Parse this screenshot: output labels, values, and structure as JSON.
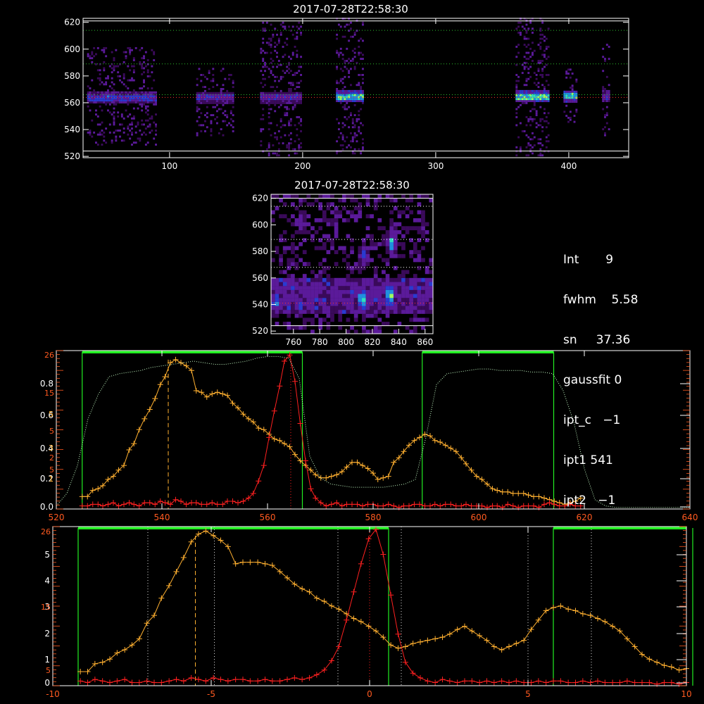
{
  "panel1": {
    "title": "2017-07-28T22:58:30",
    "xlim": [
      35,
      445
    ],
    "ylim": [
      519,
      623
    ],
    "xticks": [
      100,
      200,
      300,
      400
    ],
    "yticks": [
      520,
      540,
      560,
      580,
      600,
      620
    ],
    "hlines_dotted": [
      614,
      589,
      566
    ],
    "hlines_solid": [
      621,
      524
    ],
    "hline_red": 564,
    "bands": [
      {
        "x0": 38,
        "x1": 90,
        "ymin": 528,
        "ymax": 600,
        "core": 563,
        "hot": 0.55
      },
      {
        "x0": 120,
        "x1": 148,
        "ymin": 535,
        "ymax": 585,
        "core": 563,
        "hot": 0.45
      },
      {
        "x0": 168,
        "x1": 198,
        "ymin": 520,
        "ymax": 620,
        "core": 563,
        "hot": 0.45
      },
      {
        "x0": 225,
        "x1": 245,
        "ymin": 520,
        "ymax": 622,
        "core": 564,
        "hot": 0.85
      },
      {
        "x0": 360,
        "x1": 385,
        "ymin": 520,
        "ymax": 622,
        "core": 564,
        "hot": 0.9
      },
      {
        "x0": 396,
        "x1": 405,
        "ymin": 545,
        "ymax": 585,
        "core": 564,
        "hot": 0.85
      },
      {
        "x0": 425,
        "x1": 430,
        "ymin": 535,
        "ymax": 605,
        "core": 564,
        "hot": 0.5
      }
    ]
  },
  "panel2": {
    "title": "2017-07-28T22:58:30",
    "xlim": [
      743,
      866
    ],
    "ylim": [
      518,
      623
    ],
    "xticks": [
      760,
      780,
      800,
      820,
      840,
      860
    ],
    "yticks": [
      520,
      540,
      560,
      580,
      600,
      620
    ],
    "hlines_dotted": [
      614,
      589,
      568
    ],
    "hlines_solid": [
      620,
      524
    ],
    "hline_red": 541
  },
  "info": {
    "lines": [
      "Int       9",
      "fwhm    5.58",
      "sn     37.36",
      "gaussfit 0",
      "ipt_c   −1",
      "ipt1 541",
      "ipt2   −1"
    ]
  },
  "chart_data": [
    {
      "type": "line",
      "name": "panel3",
      "xlim": [
        520,
        640
      ],
      "xticks": [
        520,
        540,
        560,
        580,
        600,
        620,
        640
      ],
      "left_ticks_white": [
        "0.0",
        "0.2",
        "0.4",
        "0.6",
        "0.8"
      ],
      "left_ticks_red": [
        "5",
        "2",
        "5",
        "15",
        "26"
      ],
      "left_ticks_orange": [
        "1",
        "3",
        "5"
      ],
      "green_windows": [
        [
          524.9,
          566.6
        ],
        [
          589.3,
          614.2
        ]
      ],
      "vlines": [
        {
          "x": 541.2,
          "style": "dashed",
          "color": "orange"
        },
        {
          "x": 564.4,
          "style": "dotted",
          "color": "red"
        }
      ],
      "series": [
        {
          "color": "orange",
          "marker": "plus",
          "x": [
            524.9,
            525.9,
            526.9,
            527.9,
            528.8,
            529.8,
            530.8,
            531.8,
            532.8,
            533.8,
            534.7,
            535.7,
            536.7,
            537.7,
            538.7,
            539.7,
            540.6,
            541.6,
            542.6,
            543.6,
            544.6,
            545.6,
            546.5,
            547.5,
            548.5,
            549.5,
            550.5,
            551.5,
            552.4,
            553.4,
            554.4,
            555.4,
            556.4,
            557.3,
            558.3,
            559.3,
            560.3,
            561.3,
            562.3,
            563.2,
            564.2,
            565.2,
            566.2,
            567.2,
            568.2,
            569.1,
            570.1,
            571.1,
            572.1,
            573.1,
            574.1,
            575.0,
            576.0,
            577.0,
            578.0,
            579.0,
            580.0,
            580.9,
            581.9,
            582.9,
            583.9,
            584.9,
            585.8,
            586.8,
            587.8,
            588.8,
            589.8,
            590.8,
            591.7,
            592.7,
            593.7,
            594.7,
            595.7,
            596.7,
            597.6,
            598.6,
            599.6,
            600.6,
            601.6,
            602.6,
            603.5,
            604.5,
            605.5,
            606.5,
            607.5,
            608.5,
            609.4,
            610.4,
            611.4,
            612.4,
            613.4,
            614.3,
            615.3,
            616.3,
            617.3,
            618.3,
            619.3
          ],
          "y": [
            0.08,
            0.08,
            0.12,
            0.13,
            0.15,
            0.19,
            0.21,
            0.25,
            0.28,
            0.38,
            0.42,
            0.51,
            0.58,
            0.64,
            0.71,
            0.8,
            0.85,
            0.94,
            0.96,
            0.94,
            0.92,
            0.89,
            0.76,
            0.75,
            0.72,
            0.74,
            0.75,
            0.74,
            0.73,
            0.68,
            0.65,
            0.61,
            0.58,
            0.56,
            0.52,
            0.51,
            0.48,
            0.45,
            0.44,
            0.42,
            0.4,
            0.35,
            0.31,
            0.28,
            0.25,
            0.22,
            0.2,
            0.2,
            0.21,
            0.22,
            0.24,
            0.27,
            0.3,
            0.3,
            0.28,
            0.26,
            0.23,
            0.19,
            0.2,
            0.21,
            0.3,
            0.33,
            0.37,
            0.41,
            0.44,
            0.46,
            0.48,
            0.47,
            0.44,
            0.43,
            0.41,
            0.39,
            0.37,
            0.33,
            0.29,
            0.25,
            0.21,
            0.19,
            0.16,
            0.13,
            0.12,
            0.11,
            0.11,
            0.1,
            0.1,
            0.1,
            0.09,
            0.08,
            0.08,
            0.07,
            0.06,
            0.05,
            0.04,
            0.03,
            0.04,
            0.05,
            0.07
          ]
        },
        {
          "color": "red",
          "marker": "plus",
          "x": [
            524.9,
            525.9,
            526.9,
            527.9,
            528.8,
            529.8,
            530.8,
            531.8,
            532.8,
            533.8,
            534.7,
            535.7,
            536.7,
            537.7,
            538.7,
            539.7,
            540.6,
            541.6,
            542.6,
            543.6,
            544.6,
            545.6,
            546.5,
            547.5,
            548.5,
            549.5,
            550.5,
            551.5,
            552.4,
            553.4,
            554.4,
            555.4,
            556.4,
            557.3,
            558.3,
            559.3,
            560.3,
            561.3,
            562.3,
            563.2,
            564.2,
            565.2,
            566.2,
            567.2,
            568.2,
            569.1,
            570.1,
            571.1,
            572.1,
            573.1,
            574.1,
            575.0,
            576.0,
            577.0,
            578.0,
            579.0,
            580.0,
            580.9,
            581.9,
            582.9,
            583.9,
            584.9,
            585.8,
            586.8,
            587.8,
            588.8,
            589.8,
            590.8,
            591.7,
            592.7,
            593.7,
            594.7,
            595.7,
            596.7,
            597.6,
            598.6,
            599.6,
            600.6,
            601.6,
            602.6,
            603.5,
            604.5,
            605.5,
            606.5,
            607.5,
            608.5,
            609.4,
            610.4,
            611.4,
            612.4,
            613.4,
            614.3,
            615.3,
            616.3,
            617.3,
            618.3,
            619.3
          ],
          "y": [
            0.02,
            0.02,
            0.03,
            0.03,
            0.02,
            0.03,
            0.04,
            0.02,
            0.03,
            0.04,
            0.03,
            0.02,
            0.04,
            0.04,
            0.03,
            0.05,
            0.04,
            0.03,
            0.06,
            0.05,
            0.03,
            0.04,
            0.04,
            0.03,
            0.03,
            0.04,
            0.03,
            0.03,
            0.05,
            0.05,
            0.04,
            0.05,
            0.07,
            0.1,
            0.18,
            0.28,
            0.46,
            0.63,
            0.79,
            0.95,
            0.99,
            0.82,
            0.55,
            0.31,
            0.13,
            0.07,
            0.04,
            0.02,
            0.03,
            0.04,
            0.02,
            0.03,
            0.03,
            0.03,
            0.02,
            0.03,
            0.03,
            0.02,
            0.02,
            0.03,
            0.02,
            0.01,
            0.02,
            0.02,
            0.03,
            0.03,
            0.02,
            0.02,
            0.03,
            0.02,
            0.03,
            0.03,
            0.02,
            0.02,
            0.03,
            0.02,
            0.02,
            0.02,
            0.01,
            0.02,
            0.02,
            0.01,
            0.03,
            0.02,
            0.01,
            0.02,
            0.02,
            0.02,
            0.01,
            0.03,
            0.04,
            0.03,
            0.02,
            0.02,
            0.03,
            0.02,
            0.02
          ]
        },
        {
          "color": "lightgreen",
          "style": "dotted",
          "x": [
            520,
            522,
            524,
            526,
            528,
            530,
            532,
            534,
            536,
            538,
            540,
            542,
            544,
            546,
            548,
            550,
            552,
            554,
            556,
            558,
            560,
            562,
            564,
            566,
            568,
            570,
            572,
            574,
            576,
            578,
            580,
            582,
            584,
            586,
            588,
            590,
            592,
            594,
            596,
            598,
            600,
            602,
            604,
            606,
            608,
            610,
            612,
            614,
            616,
            618,
            620,
            622,
            624,
            626,
            628,
            630,
            632,
            634,
            636,
            638,
            640
          ],
          "y": [
            0.02,
            0.1,
            0.28,
            0.58,
            0.74,
            0.85,
            0.87,
            0.88,
            0.89,
            0.91,
            0.92,
            0.93,
            0.94,
            0.95,
            0.94,
            0.93,
            0.93,
            0.94,
            0.95,
            0.97,
            0.98,
            0.98,
            0.97,
            0.84,
            0.34,
            0.2,
            0.16,
            0.15,
            0.14,
            0.14,
            0.14,
            0.14,
            0.15,
            0.16,
            0.19,
            0.46,
            0.8,
            0.87,
            0.88,
            0.89,
            0.9,
            0.9,
            0.89,
            0.89,
            0.89,
            0.88,
            0.88,
            0.87,
            0.76,
            0.56,
            0.26,
            0.06,
            0.02,
            0.01,
            0.01,
            0.01,
            0.01,
            0.01,
            0.01,
            0.01,
            0.01
          ]
        }
      ]
    },
    {
      "type": "line",
      "name": "panel4",
      "xlim": [
        -10,
        10
      ],
      "xticks": [
        -10,
        -5,
        0,
        5,
        10
      ],
      "left_ticks_white": [
        "0",
        "1",
        "2",
        "3",
        "4",
        "5"
      ],
      "left_ticks_red": [
        "5",
        "15",
        "26"
      ],
      "green_windows": [
        [
          -9.2,
          0.6
        ],
        [
          5.8,
          10.2
        ]
      ],
      "vlines": [
        {
          "x": -5.5,
          "style": "dashed",
          "color": "orange"
        },
        {
          "x": 0.0,
          "style": "dotted",
          "color": "red"
        }
      ],
      "vlines_white": [
        -7.0,
        -4.9,
        -1.0,
        1.0,
        5.0,
        7.0
      ],
      "series": [
        {
          "color": "orange",
          "marker": "plus",
          "x": [
            -9.13,
            -8.9,
            -8.67,
            -8.43,
            -8.2,
            -7.97,
            -7.73,
            -7.5,
            -7.27,
            -7.03,
            -6.8,
            -6.57,
            -6.33,
            -6.1,
            -5.87,
            -5.63,
            -5.4,
            -5.17,
            -4.93,
            -4.7,
            -4.47,
            -4.23,
            -4.0,
            -3.77,
            -3.53,
            -3.3,
            -3.07,
            -2.83,
            -2.6,
            -2.37,
            -2.13,
            -1.9,
            -1.67,
            -1.43,
            -1.2,
            -0.97,
            -0.73,
            -0.5,
            -0.27,
            -0.03,
            0.2,
            0.43,
            0.67,
            0.9,
            1.13,
            1.37,
            1.6,
            1.83,
            2.07,
            2.3,
            2.53,
            2.77,
            3.0,
            3.23,
            3.47,
            3.7,
            3.93,
            4.17,
            4.4,
            4.63,
            4.87,
            5.1,
            5.33,
            5.57,
            5.8,
            6.03,
            6.27,
            6.5,
            6.73,
            6.97,
            7.2,
            7.43,
            7.67,
            7.9,
            8.13,
            8.37,
            8.6,
            8.83,
            9.07,
            9.3,
            9.53,
            9.77,
            10.0
          ],
          "y": [
            0.09,
            0.09,
            0.14,
            0.15,
            0.17,
            0.21,
            0.23,
            0.26,
            0.3,
            0.4,
            0.45,
            0.56,
            0.64,
            0.73,
            0.82,
            0.92,
            0.97,
            0.99,
            0.96,
            0.93,
            0.89,
            0.78,
            0.79,
            0.79,
            0.79,
            0.78,
            0.77,
            0.73,
            0.69,
            0.65,
            0.62,
            0.6,
            0.56,
            0.54,
            0.51,
            0.49,
            0.46,
            0.43,
            0.41,
            0.38,
            0.35,
            0.31,
            0.26,
            0.24,
            0.25,
            0.27,
            0.28,
            0.29,
            0.3,
            0.31,
            0.33,
            0.36,
            0.38,
            0.35,
            0.32,
            0.29,
            0.25,
            0.23,
            0.25,
            0.27,
            0.29,
            0.36,
            0.42,
            0.48,
            0.5,
            0.51,
            0.49,
            0.48,
            0.46,
            0.45,
            0.43,
            0.41,
            0.38,
            0.35,
            0.3,
            0.25,
            0.2,
            0.17,
            0.15,
            0.13,
            0.12,
            0.1,
            0.11
          ]
        },
        {
          "color": "red",
          "marker": "plus",
          "x": [
            -9.13,
            -8.9,
            -8.67,
            -8.43,
            -8.2,
            -7.97,
            -7.73,
            -7.5,
            -7.27,
            -7.03,
            -6.8,
            -6.57,
            -6.33,
            -6.1,
            -5.87,
            -5.63,
            -5.4,
            -5.17,
            -4.93,
            -4.7,
            -4.47,
            -4.23,
            -4.0,
            -3.77,
            -3.53,
            -3.3,
            -3.07,
            -2.83,
            -2.6,
            -2.37,
            -2.13,
            -1.9,
            -1.67,
            -1.43,
            -1.2,
            -0.97,
            -0.73,
            -0.5,
            -0.27,
            -0.03,
            0.2,
            0.43,
            0.67,
            0.9,
            1.13,
            1.37,
            1.6,
            1.83,
            2.07,
            2.3,
            2.53,
            2.77,
            3.0,
            3.23,
            3.47,
            3.7,
            3.93,
            4.17,
            4.4,
            4.63,
            4.87,
            5.1,
            5.33,
            5.57,
            5.8,
            6.03,
            6.27,
            6.5,
            6.73,
            6.97,
            7.2,
            7.43,
            7.67,
            7.9,
            8.13,
            8.37,
            8.6,
            8.83,
            9.07,
            9.3,
            9.53,
            9.77,
            10.0
          ],
          "y": [
            0.03,
            0.02,
            0.04,
            0.03,
            0.02,
            0.03,
            0.04,
            0.02,
            0.02,
            0.03,
            0.02,
            0.02,
            0.03,
            0.04,
            0.03,
            0.05,
            0.04,
            0.03,
            0.05,
            0.04,
            0.03,
            0.04,
            0.04,
            0.03,
            0.03,
            0.04,
            0.03,
            0.03,
            0.04,
            0.05,
            0.04,
            0.05,
            0.07,
            0.1,
            0.16,
            0.25,
            0.42,
            0.6,
            0.78,
            0.94,
            1.0,
            0.84,
            0.58,
            0.33,
            0.15,
            0.08,
            0.05,
            0.03,
            0.02,
            0.04,
            0.03,
            0.02,
            0.03,
            0.03,
            0.02,
            0.03,
            0.02,
            0.03,
            0.02,
            0.03,
            0.02,
            0.02,
            0.03,
            0.02,
            0.03,
            0.03,
            0.02,
            0.02,
            0.03,
            0.02,
            0.03,
            0.02,
            0.02,
            0.02,
            0.03,
            0.02,
            0.02,
            0.02,
            0.01,
            0.02,
            0.02,
            0.01,
            0.02
          ]
        }
      ]
    }
  ],
  "colors": {
    "orange": "#ffb030",
    "red": "#ff2020",
    "green": "#22ee22",
    "lightgreen": "#c8ffc8",
    "redtick": "#ff5a20"
  }
}
